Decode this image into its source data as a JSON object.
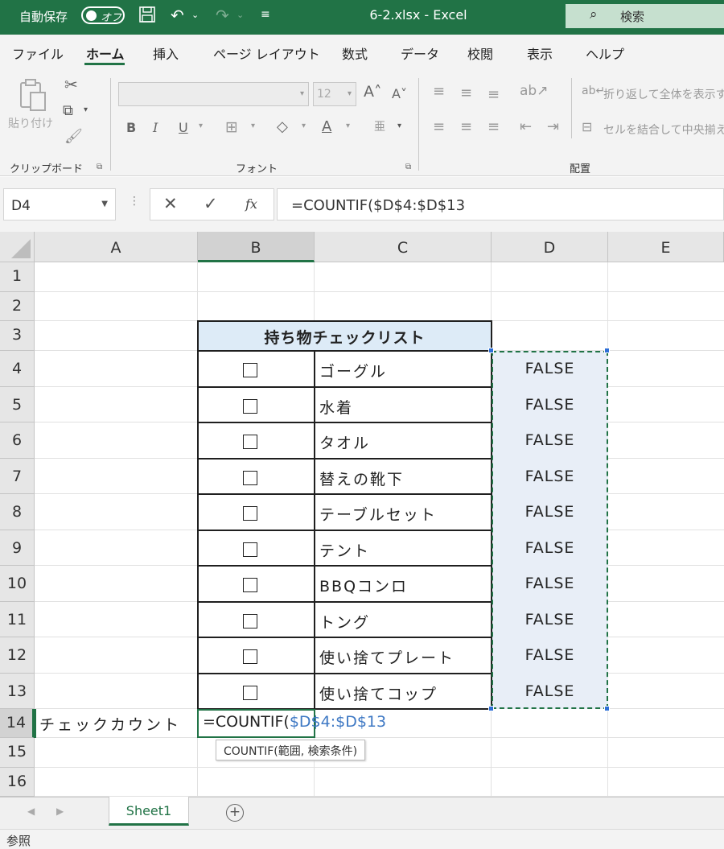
{
  "titlebar": {
    "autosave_label": "自動保存",
    "autosave_state": "オフ",
    "file_title": "6-2.xlsx  -  Excel",
    "search_label": "検索"
  },
  "menu": [
    "ファイル",
    "ホーム",
    "挿入",
    "ページ レイアウト",
    "数式",
    "データ",
    "校閲",
    "表示",
    "ヘルプ"
  ],
  "menu_active": "ホーム",
  "ribbon": {
    "paste_label": "貼り付け",
    "clipboard_label": "クリップボード",
    "font_label": "フォント",
    "alignment_label": "配置",
    "font_size": "12",
    "wrap_text": "折り返して全体を表示す",
    "merge_center": "セルを結合して中央揃え",
    "bold": "B",
    "italic": "I",
    "underline": "U"
  },
  "formula_bar": {
    "name_box": "D4",
    "formula": "=COUNTIF($D$4:$D$13"
  },
  "columns": [
    "A",
    "B",
    "C",
    "D",
    "E"
  ],
  "rows": [
    "1",
    "2",
    "3",
    "4",
    "5",
    "6",
    "7",
    "8",
    "9",
    "10",
    "11",
    "12",
    "13",
    "14",
    "15",
    "16"
  ],
  "sheet": {
    "title": "持ち物チェックリスト",
    "items": [
      "ゴーグル",
      "水着",
      "タオル",
      "替えの靴下",
      "テーブルセット",
      "テント",
      "BBQコンロ",
      "トング",
      "使い捨てプレート",
      "使い捨てコップ"
    ],
    "values": [
      "FALSE",
      "FALSE",
      "FALSE",
      "FALSE",
      "FALSE",
      "FALSE",
      "FALSE",
      "FALSE",
      "FALSE",
      "FALSE"
    ],
    "count_label": "チェックカウント",
    "formula_prefix": "=COUNTIF(",
    "formula_ref": "$D$4:$D$13",
    "tooltip": "COUNTIF(範囲, 検索条件)"
  },
  "sheet_tab": "Sheet1",
  "status": "参照",
  "colors": {
    "accent": "#217346",
    "header_fill": "#ddebf7",
    "ref": "#3f79c4"
  }
}
